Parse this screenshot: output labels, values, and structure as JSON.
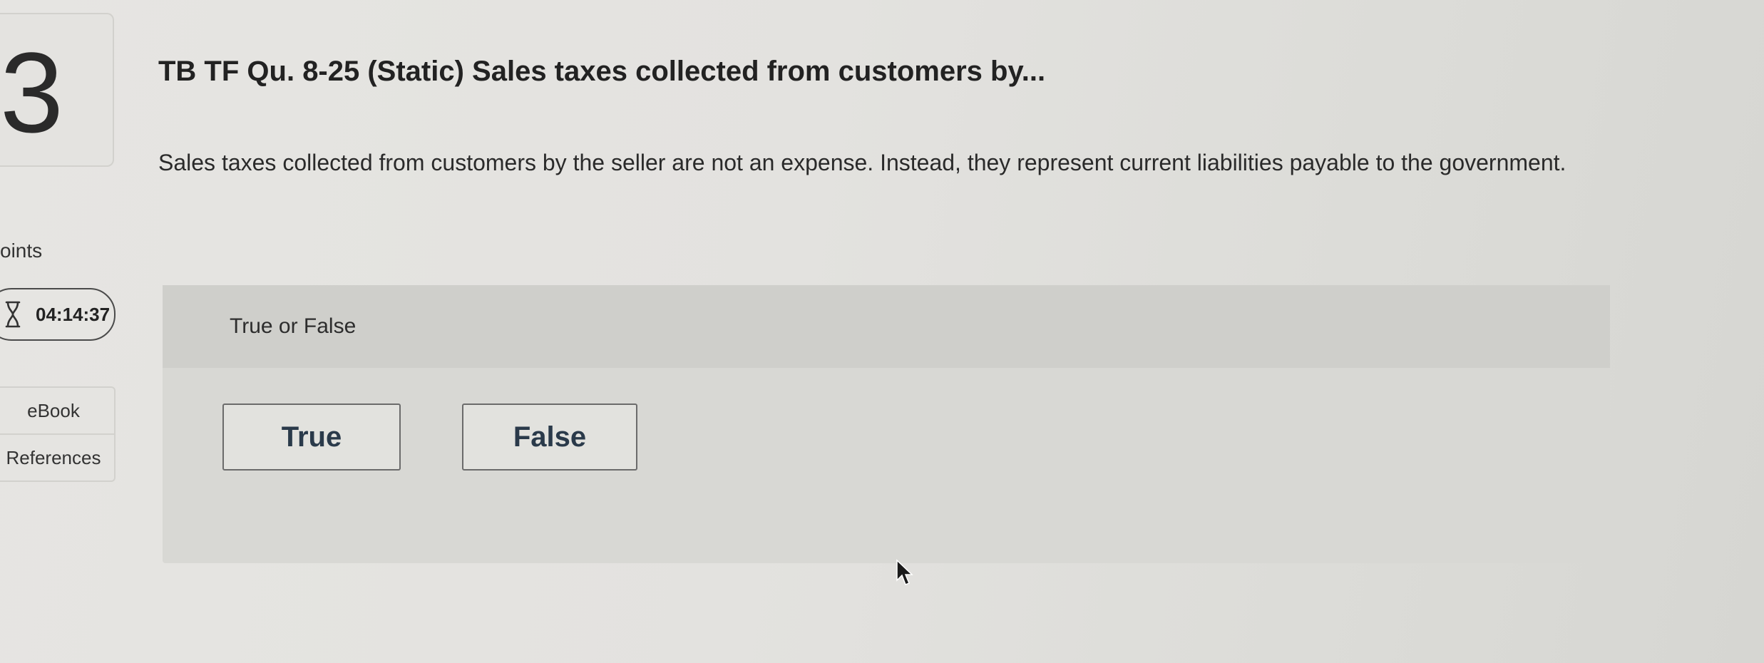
{
  "question": {
    "number": "3",
    "title": "TB TF Qu. 8-25 (Static) Sales taxes collected from customers by...",
    "text": "Sales taxes collected from customers by the seller are not an expense. Instead, they represent current liabilities payable to the government."
  },
  "sidebar": {
    "points_label": "oints",
    "timer": "04:14:37",
    "resources": [
      "eBook",
      "References"
    ]
  },
  "answer": {
    "prompt": "True or False",
    "options": [
      "True",
      "False"
    ]
  },
  "icons": {
    "timer": "hourglass-icon",
    "cursor": "mouse-pointer-icon"
  }
}
